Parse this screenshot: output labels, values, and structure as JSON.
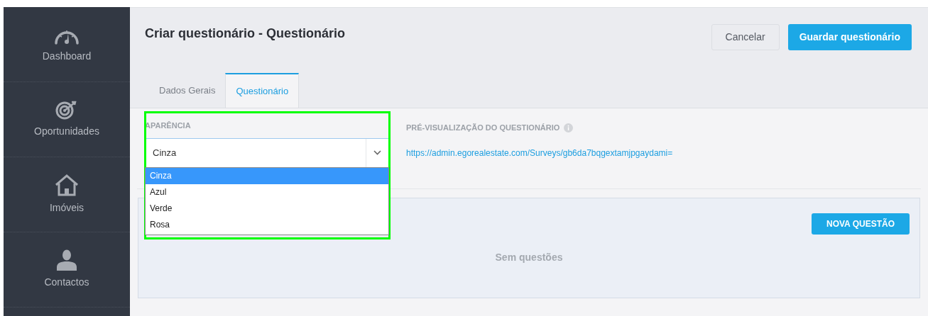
{
  "sidebar": {
    "items": [
      {
        "label": "Dashboard",
        "kind": "gauge"
      },
      {
        "label": "Oportunidades",
        "kind": "target"
      },
      {
        "label": "Imóveis",
        "kind": "house"
      },
      {
        "label": "Contactos",
        "kind": "person"
      }
    ]
  },
  "header": {
    "title": "Criar questionário - Questionário",
    "buttons": [
      {
        "label": "Cancelar",
        "kind": "secondary"
      },
      {
        "label": "Guardar questionário",
        "kind": "primary"
      }
    ]
  },
  "tabs": [
    {
      "label": "Dados Gerais",
      "selected": false
    },
    {
      "label": "Questionário",
      "selected": true
    }
  ],
  "appearance": {
    "label": "APARÊNCIA",
    "value": "Cinza",
    "expanded": true,
    "options": [
      {
        "label": "Cinza",
        "selected": true
      },
      {
        "label": "Azul",
        "selected": false
      },
      {
        "label": "Verde",
        "selected": false
      },
      {
        "label": "Rosa",
        "selected": false
      }
    ]
  },
  "preview": {
    "label": "PRÉ-VISUALIZAÇÃO DO QUESTIONÁRIO",
    "url": "https://admin.egorealestate.com/Surveys/gb6da7bqgextamjpgaydami="
  },
  "questions": {
    "button": "NOVA QUESTÃO",
    "empty": "Sem questões"
  }
}
